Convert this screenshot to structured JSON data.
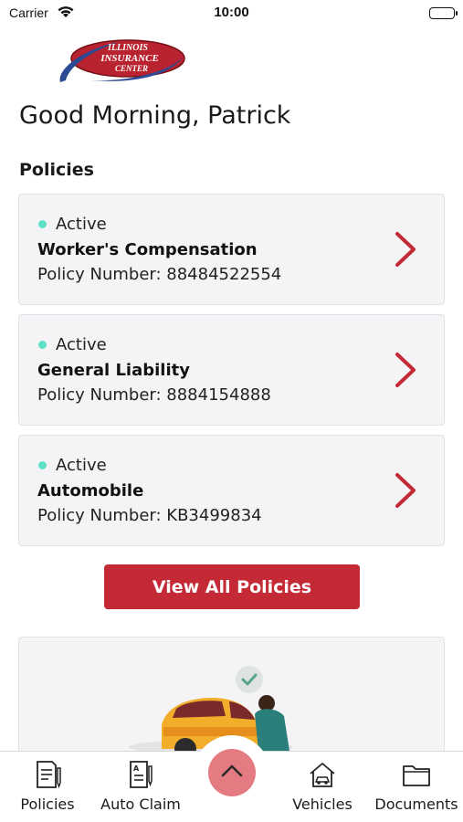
{
  "status_bar": {
    "carrier": "Carrier",
    "time": "10:00"
  },
  "logo": {
    "alt": "Illinois Insurance Center",
    "line1": "ILLINOIS",
    "line2": "INSURANCE",
    "line3": "CENTER"
  },
  "greeting": "Good Morning, Patrick",
  "policies_section": {
    "title": "Policies",
    "items": [
      {
        "status": "Active",
        "name": "Worker's Compensation",
        "number": "Policy Number: 88484522554"
      },
      {
        "status": "Active",
        "name": "General Liability",
        "number": "Policy Number: 8884154888"
      },
      {
        "status": "Active",
        "name": "Automobile",
        "number": "Policy Number: KB3499834"
      }
    ],
    "view_all_label": "View All Policies"
  },
  "tab_bar": {
    "tabs": [
      {
        "label": "Policies",
        "icon": "document-pen-icon"
      },
      {
        "label": "Auto Claim",
        "icon": "claim-form-icon"
      },
      {
        "label": "Vehicles",
        "icon": "car-house-icon"
      },
      {
        "label": "Documents",
        "icon": "folder-icon"
      }
    ],
    "center_icon": "chevron-up-icon"
  },
  "colors": {
    "accent": "#c42a35",
    "active_dot": "#5fe0c6",
    "card_bg": "#f4f4f6",
    "center_button": "#e57b82"
  }
}
